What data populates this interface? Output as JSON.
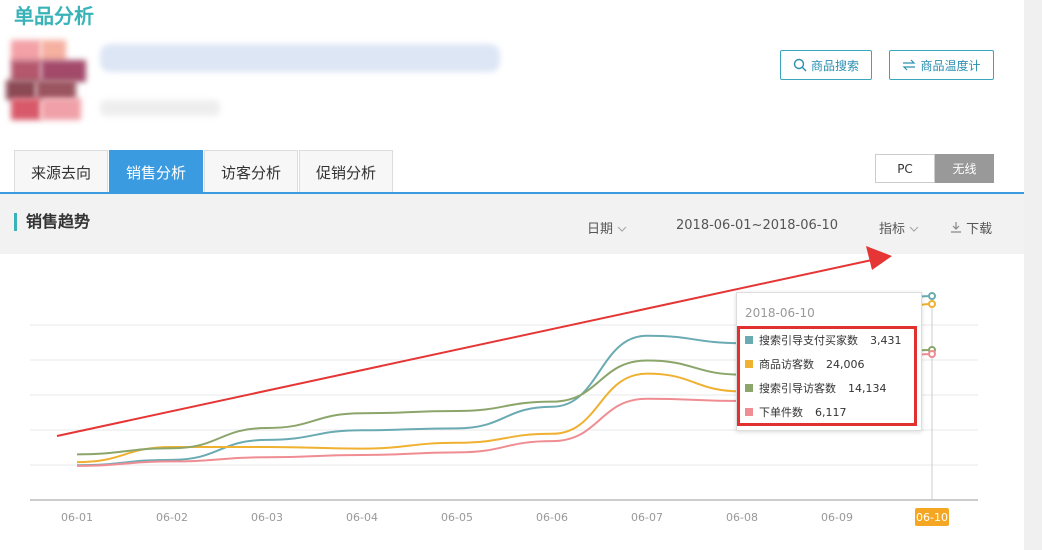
{
  "page_title": "单品分析",
  "buttons": {
    "product_search": "商品搜索",
    "product_temp": "商品温度计"
  },
  "tabs": [
    {
      "label": "来源去向",
      "active": false
    },
    {
      "label": "销售分析",
      "active": true
    },
    {
      "label": "访客分析",
      "active": false
    },
    {
      "label": "促销分析",
      "active": false
    }
  ],
  "device": {
    "pc": "PC",
    "wireless": "无线",
    "selected": "无线"
  },
  "section": {
    "title": "销售趋势",
    "date_label": "日期",
    "date_range": "2018-06-01~2018-06-10",
    "metric_label": "指标",
    "download_label": "下载"
  },
  "icons": {
    "search": "search-icon",
    "swap": "swap-icon",
    "download": "download-icon",
    "chevron": "chevron-down-icon"
  },
  "colors": {
    "accent": "#39b3b8",
    "tab_active": "#3a9be0",
    "highlight": "#e03030",
    "date_badge": "#f5a623"
  },
  "chart_data": {
    "type": "line",
    "categories": [
      "06-01",
      "06-02",
      "06-03",
      "06-04",
      "06-05",
      "06-06",
      "06-07",
      "06-08",
      "06-09",
      "06-10"
    ],
    "highlighted_category": "06-10",
    "series": [
      {
        "name": "搜索引导支付买家数",
        "color": "#6aabb3",
        "values": [
          1080,
          1250,
          1870,
          2170,
          2230,
          2900,
          5110,
          4880,
          null,
          3431
        ]
      },
      {
        "name": "商品访客数",
        "color": "#f0b030",
        "values": [
          1180,
          1650,
          1650,
          1600,
          1780,
          2060,
          3930,
          3380,
          null,
          24006
        ]
      },
      {
        "name": "搜索引导访客数",
        "color": "#8ba56a",
        "values": [
          1420,
          1610,
          2240,
          2700,
          2770,
          3060,
          4340,
          3900,
          null,
          14134
        ]
      },
      {
        "name": "下单件数",
        "color": "#ef8d93",
        "values": [
          1060,
          1200,
          1330,
          1400,
          1480,
          1830,
          3150,
          3080,
          null,
          6117
        ]
      }
    ],
    "tooltip": {
      "date": "2018-06-10",
      "rows": [
        {
          "name": "搜索引导支付买家数",
          "value": "3,431"
        },
        {
          "name": "商品访客数",
          "value": "24,006"
        },
        {
          "name": "搜索引导访客数",
          "value": "14,134"
        },
        {
          "name": "下单件数",
          "value": "6,117"
        }
      ]
    },
    "grid": true
  }
}
